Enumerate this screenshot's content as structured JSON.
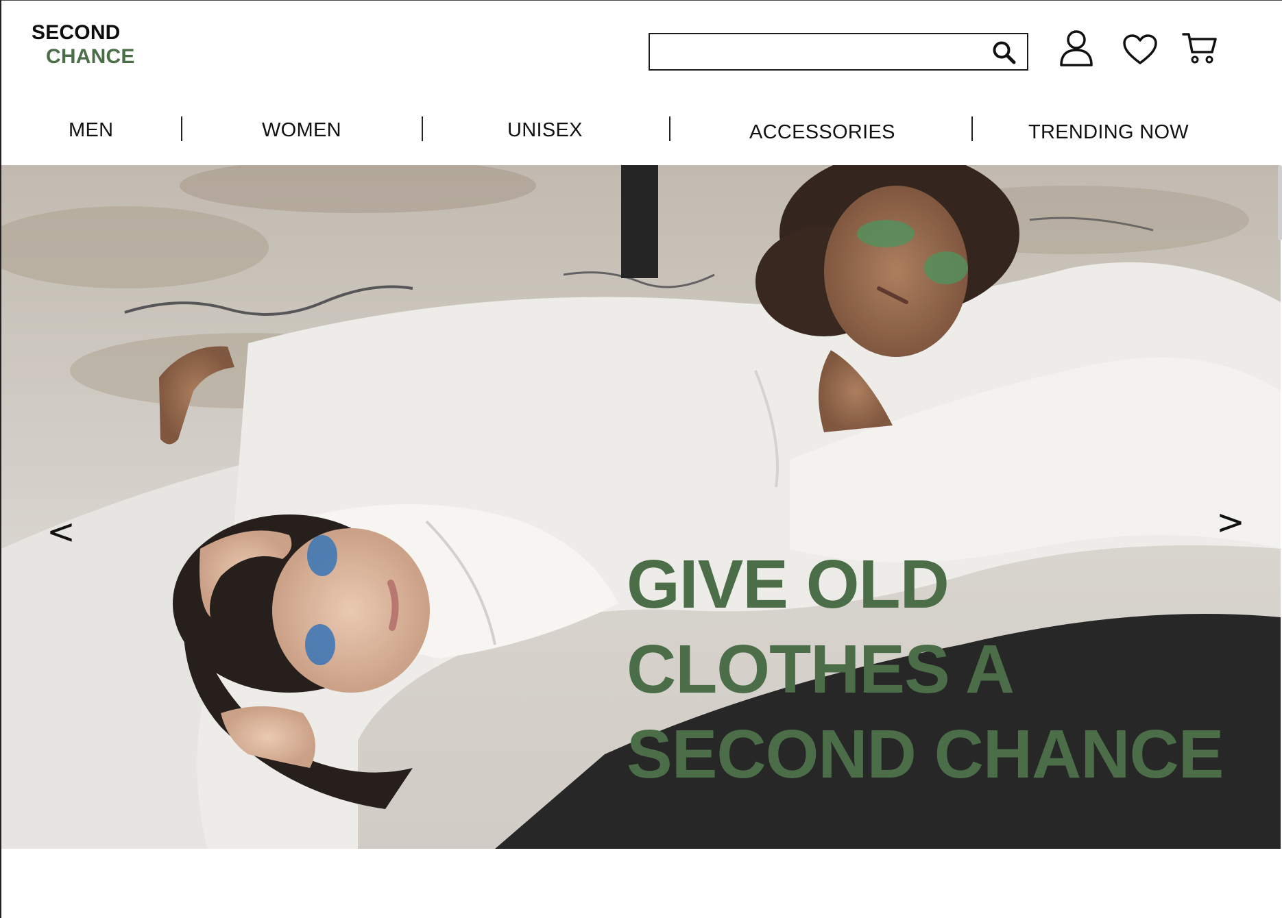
{
  "brand": {
    "line1": "SECOND",
    "line2": "CHANCE",
    "accent_color": "#4b6e48"
  },
  "search": {
    "value": "",
    "placeholder": "",
    "icon": "search-icon"
  },
  "header_icons": [
    "account-icon",
    "wishlist-heart-icon",
    "cart-icon"
  ],
  "nav": {
    "items": [
      {
        "label": "MEN"
      },
      {
        "label": "WOMEN"
      },
      {
        "label": "UNISEX"
      },
      {
        "label": "ACCESSORIES"
      },
      {
        "label": "TRENDING NOW"
      }
    ]
  },
  "hero": {
    "prev_label": "<",
    "next_label": ">",
    "headline": [
      "GIVE OLD",
      "CLOTHES A",
      "SECOND CHANCE"
    ],
    "headline_color": "#4b6e48"
  }
}
